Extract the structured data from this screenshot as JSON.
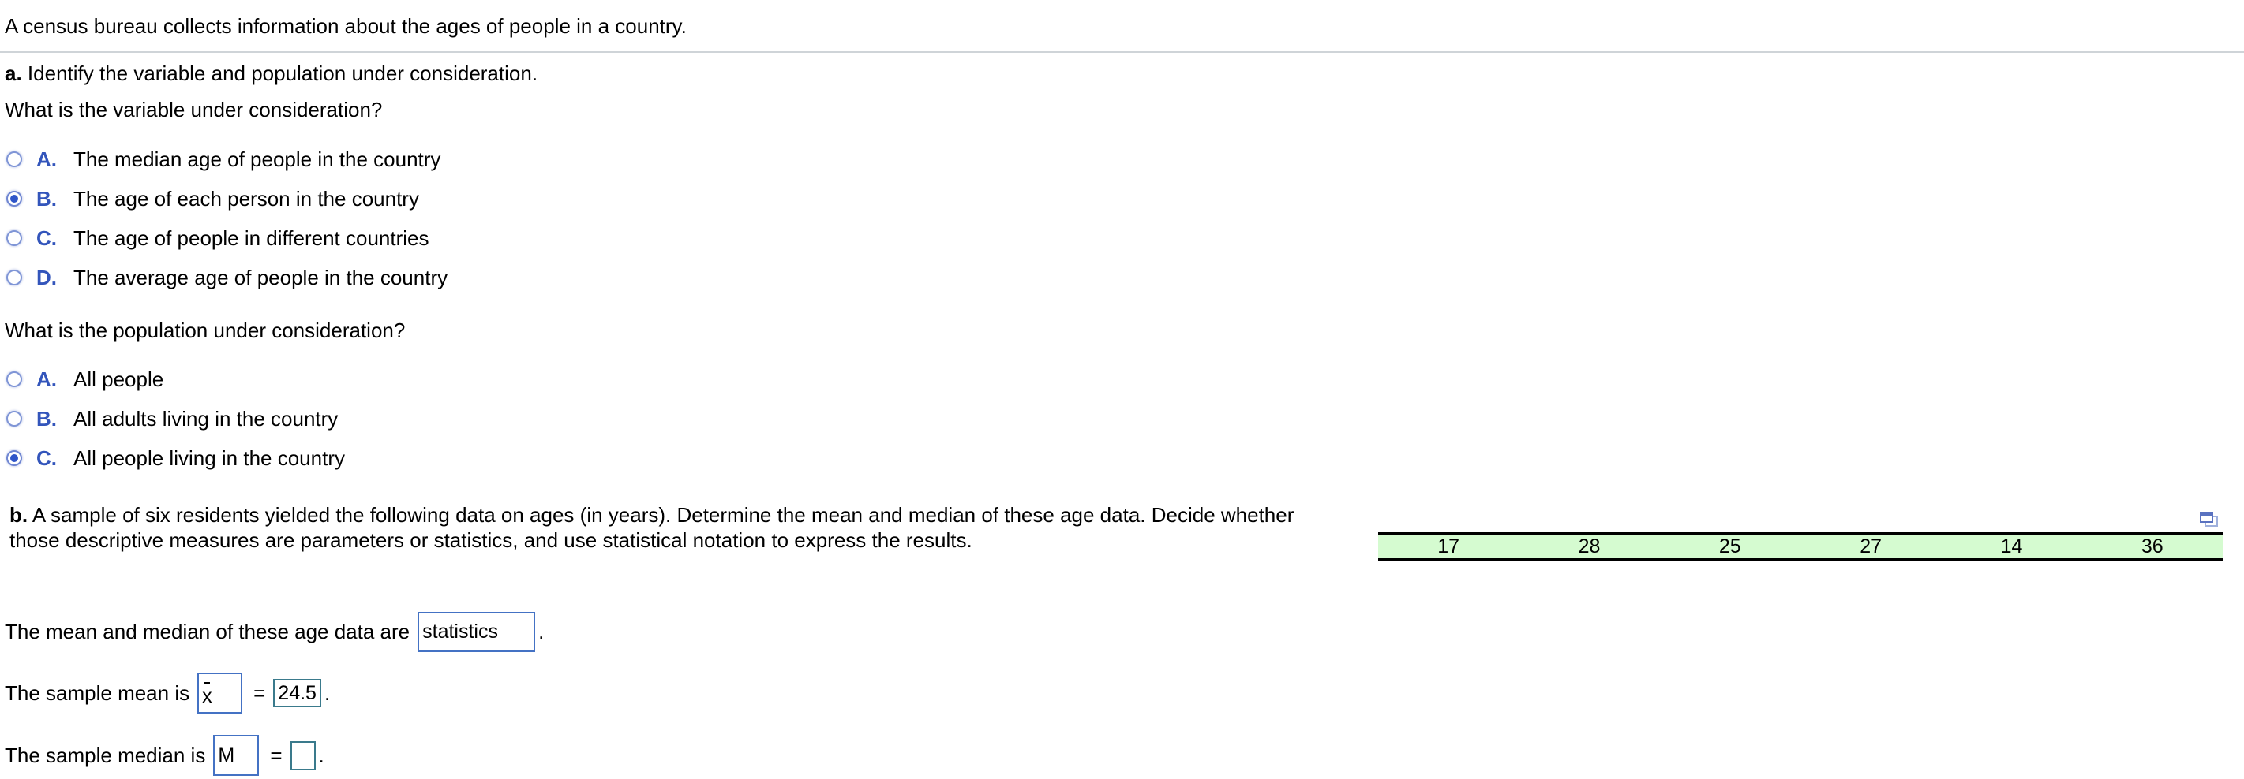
{
  "intro": "A census bureau collects information about the ages of people in a country.",
  "part_a": {
    "label": "a.",
    "instruction": "Identify the variable and population under consideration.",
    "variable_question": "What is the variable under consideration?",
    "variable_options": [
      {
        "letter": "A.",
        "text": "The median age of people in the country",
        "selected": false
      },
      {
        "letter": "B.",
        "text": "The age of each person in the country",
        "selected": true
      },
      {
        "letter": "C.",
        "text": "The age of people in different countries",
        "selected": false
      },
      {
        "letter": "D.",
        "text": "The average age of people in the country",
        "selected": false
      }
    ],
    "population_question": "What is the population under consideration?",
    "population_options": [
      {
        "letter": "A.",
        "text": "All people",
        "selected": false
      },
      {
        "letter": "B.",
        "text": "All adults living in the country",
        "selected": false
      },
      {
        "letter": "C.",
        "text": "All people living in the country",
        "selected": true
      }
    ]
  },
  "part_b": {
    "label": "b.",
    "line1": "A sample of six residents yielded the following data on ages (in years). Determine the mean and median of these age data. Decide whether",
    "line2": "those descriptive measures are parameters or statistics, and use statistical notation to express the results.",
    "ages": [
      "17",
      "28",
      "25",
      "27",
      "14",
      "36"
    ],
    "popout_icon": "popout-window-icon",
    "answers": {
      "measures_prefix": "The mean and median of these age data are",
      "measures_value": "statistics",
      "mean_prefix": "The sample mean is",
      "mean_symbol": "x",
      "mean_value": "24.5",
      "median_prefix": "The sample median is",
      "median_symbol": "M",
      "median_value": "",
      "equals": "=",
      "period": "."
    }
  },
  "colors": {
    "option_letter": "#3355bb",
    "radio_fill": "#2f55c8",
    "table_bg": "#d5fbd0",
    "input_border": "#4472c4",
    "answer_border": "#3a7a8c"
  }
}
